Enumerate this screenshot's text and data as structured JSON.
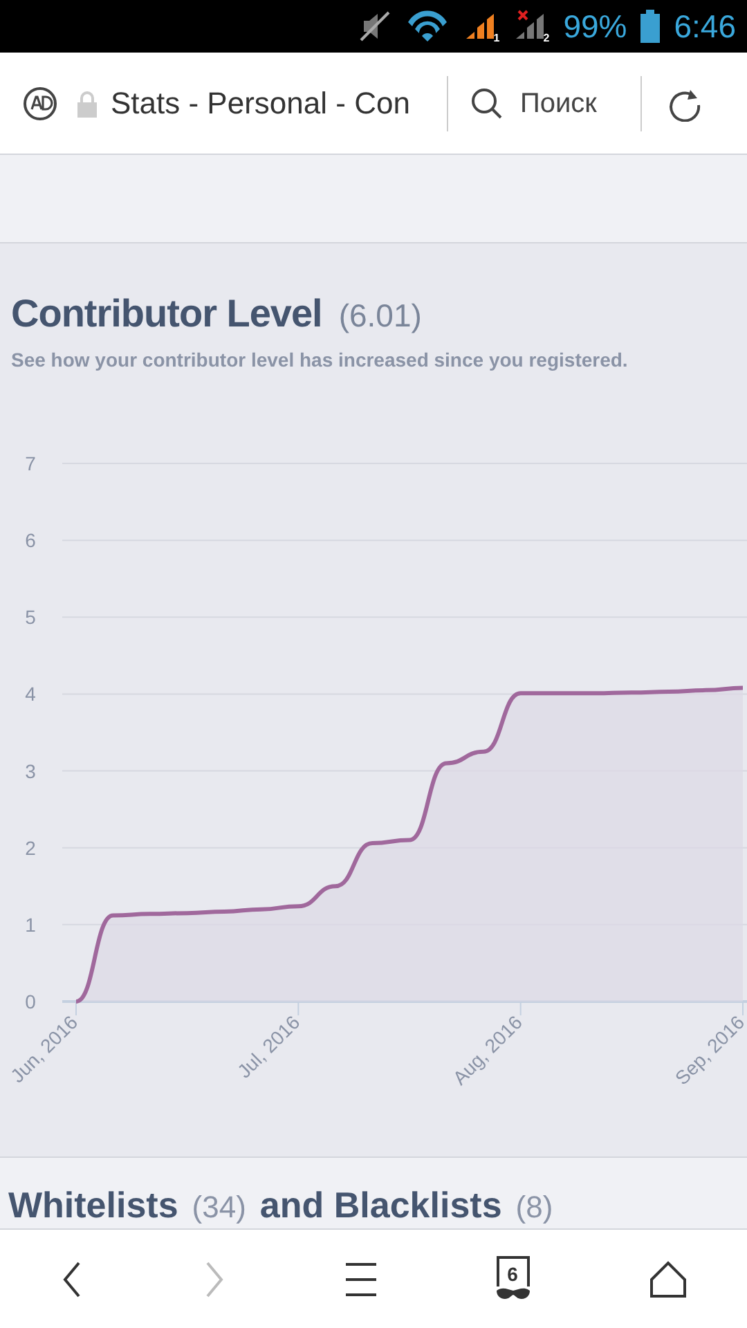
{
  "status_bar": {
    "sims": [
      {
        "label": "1",
        "no_service": false
      },
      {
        "label": "2",
        "no_service": true
      }
    ],
    "battery": "99%",
    "time": "6:46"
  },
  "browser": {
    "address": "Stats - Personal - Con",
    "search_placeholder": "Поиск",
    "tab_count": "6",
    "forward_disabled": true
  },
  "contributor_level": {
    "title": "Contributor Level",
    "value": "(6.01)",
    "description": "See how your contributor level has increased since you registered.",
    "chart_data": {
      "type": "area",
      "categories": [
        "Jun, 2016",
        null,
        null,
        null,
        null,
        null,
        "Jul, 2016",
        null,
        null,
        null,
        null,
        null,
        "Aug, 2016",
        null,
        null,
        null,
        null,
        null,
        "Sep, 2016"
      ],
      "series": [
        {
          "color": "#a0689c",
          "values": [
            0,
            1.12,
            1.14,
            1.15,
            1.17,
            1.2,
            1.24,
            1.5,
            2.06,
            2.1,
            3.1,
            3.25,
            4.01,
            4.01,
            4.01,
            4.02,
            4.03,
            4.05,
            4.08
          ]
        }
      ],
      "ylim": [
        0,
        7
      ],
      "yticks": [
        0,
        1,
        2,
        3,
        4,
        5,
        6,
        7
      ],
      "grid": true
    }
  },
  "lists_heading": [
    {
      "kind": "title",
      "text": "Whitelists"
    },
    {
      "kind": "count",
      "text": "(34)"
    },
    {
      "kind": "title",
      "text": "and Blacklists"
    },
    {
      "kind": "count",
      "text": "(8)"
    }
  ]
}
